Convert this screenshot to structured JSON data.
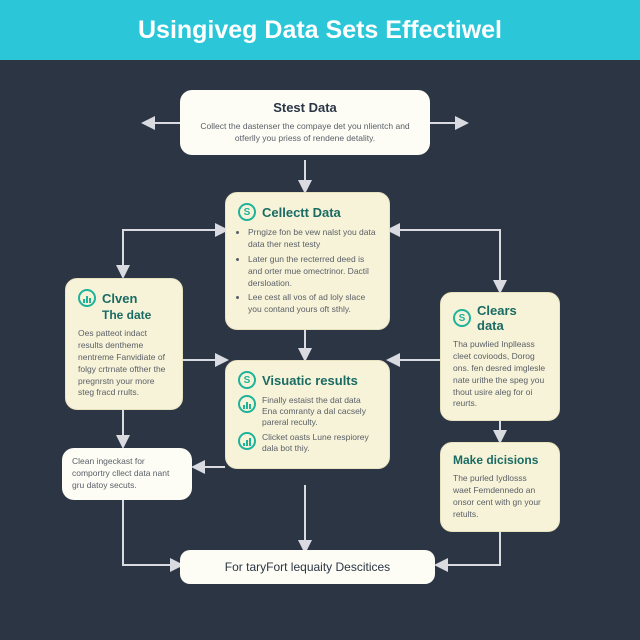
{
  "header": {
    "title": "Usingiveg Data Sets Effectiwel"
  },
  "nodes": {
    "stest": {
      "title": "Stest Data",
      "body": "Collect the dastenser the compaye det you nlientch and otferlly you priess of rendene detality."
    },
    "collect": {
      "title": "Cellectt Data",
      "b1": "Prngize fon be vew nalst you data data ther nest testy",
      "b2": "Later gun the recterred deed is and orter mue omectrinor. Dactil dersloation.",
      "b3": "Lee cest all vos of ad loly slace you contand yours oft sthly."
    },
    "clven": {
      "title": "Clven",
      "subtitle": "The date",
      "body": "Oes patteot indact results dentheme nentreme Fanvidiate of folgy crtrnate ofther the pregnrstn your more steg fracd rrults."
    },
    "clears": {
      "title": "Clears data",
      "body": "Tha puwlied Inplleass cleet covioods, Dorog ons. fen desred imglesle nate urithe the speg you thout usire aleg for oi reurts."
    },
    "visual": {
      "title": "Visuatic results",
      "l1": "Finally estaist the dat data Ena comranty a dal cacsely pareral reculty.",
      "l2": "Clicket oasts Lune respiorey dala bot thiy."
    },
    "clean2": {
      "body": "Clean ingeckast for comportry cllect data nant gru datoy secuts."
    },
    "make": {
      "title": "Make dicisions",
      "body": "The purled Iydlosss waet Femdennedo an onsor cent with gn your retults."
    }
  },
  "footer": {
    "label": "For taryFort lequaity Descitices"
  }
}
